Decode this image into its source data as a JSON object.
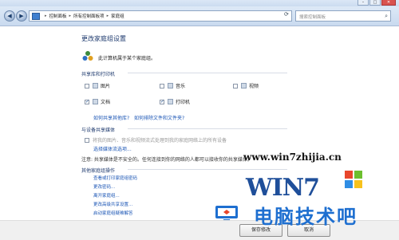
{
  "breadcrumb": [
    "控制面板",
    "所有控制面板项",
    "家庭组"
  ],
  "search": {
    "placeholder": "搜索控制面板"
  },
  "page_title": "更改家庭组设置",
  "status_text": "此计算机属于某个家庭组。",
  "share_section": {
    "title": "共享库和打印机",
    "items": [
      {
        "label": "图片",
        "checked": false
      },
      {
        "label": "音乐",
        "checked": false
      },
      {
        "label": "视频",
        "checked": false
      },
      {
        "label": "文档",
        "checked": true
      },
      {
        "label": "打印机",
        "checked": true
      }
    ],
    "link1": "如何共享其他库?",
    "link2": "如何排除文件和文件夹?"
  },
  "media_section": {
    "title": "与设备共享媒体",
    "checkbox_label": "将我的图片、音乐和视频流式处理到我的家庭网络上的所有设备",
    "link": "选择媒体流选项..."
  },
  "note": "注意: 共享媒体是不安全的。任何连接到你的网络的人都可以接收你的共享媒体。",
  "actions_section": {
    "title": "其他家庭组操作",
    "links": [
      "查看或打印家庭组密码",
      "更改密码...",
      "离开家庭组...",
      "更改高级共享设置...",
      "启动家庭组疑难解答"
    ]
  },
  "buttons": {
    "save": "保存修改",
    "cancel": "取消"
  },
  "watermark": {
    "url": "www.win7zhijia.cn",
    "logo": "WIN7",
    "subtitle": "电脑技术吧"
  },
  "colors": {
    "link": "#1a55b5",
    "heading": "#1e3a6e"
  }
}
